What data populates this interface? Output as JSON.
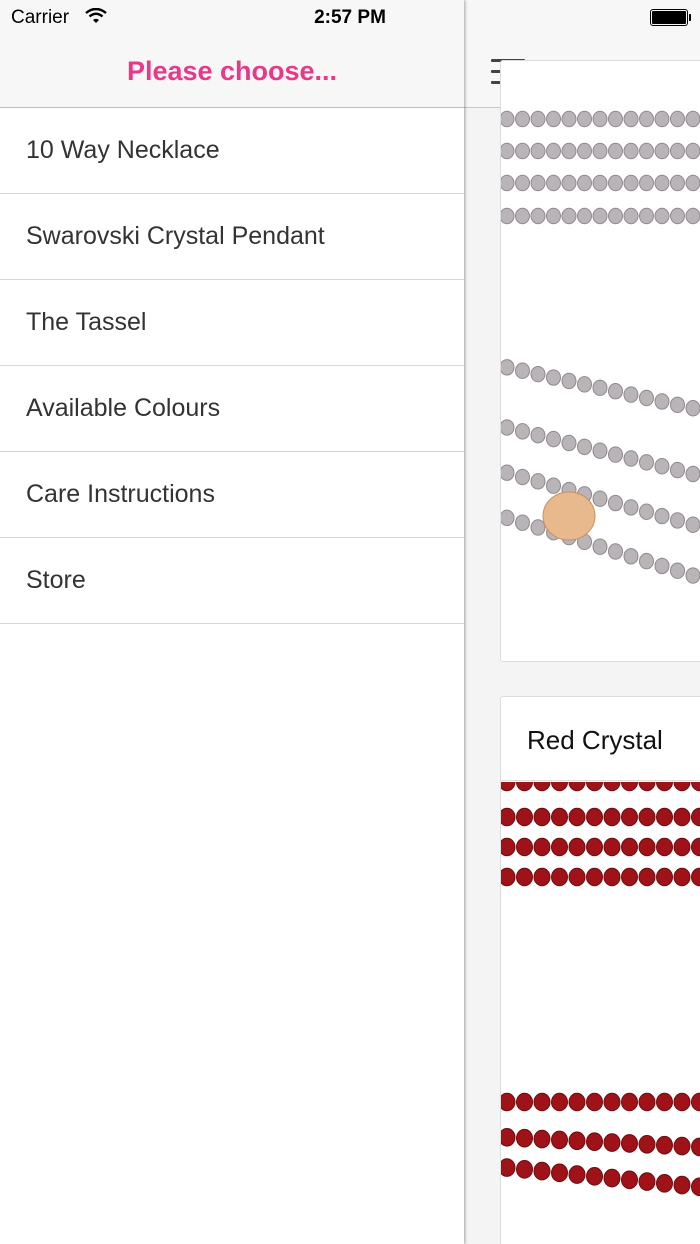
{
  "status_bar": {
    "carrier": "Carrier",
    "time": "2:57 PM"
  },
  "drawer": {
    "title": "Please choose...",
    "menu_items": [
      {
        "label": "10 Way Necklace"
      },
      {
        "label": "Swarovski Crystal Pendant"
      },
      {
        "label": "The Tassel"
      },
      {
        "label": "Available Colours"
      },
      {
        "label": "Care Instructions"
      },
      {
        "label": "Store"
      }
    ]
  },
  "main": {
    "cards": [
      {
        "title": ""
      },
      {
        "title": "Red Crystal"
      }
    ]
  },
  "colors": {
    "accent": "#e8388a",
    "grey_beads": "#b9b4b8",
    "red_beads": "#9e1218",
    "gold_clasp": "#e8b98c"
  },
  "icons": [
    "wifi-icon",
    "battery-icon",
    "hamburger-menu-icon"
  ]
}
